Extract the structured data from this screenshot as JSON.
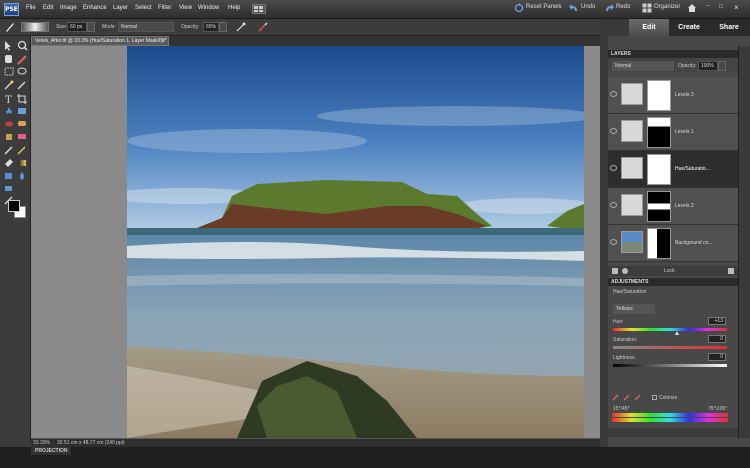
{
  "app": {
    "logo": "PSE"
  },
  "menubar": {
    "items": [
      "File",
      "Edit",
      "Image",
      "Enhance",
      "Layer",
      "Select",
      "Filter",
      "View",
      "Window",
      "Help"
    ],
    "reset_panels": "Reset Panels",
    "undo": "Undo",
    "redo": "Redo",
    "organizer": "Organizer"
  },
  "options": {
    "size_label": "Size:",
    "size_value": "60 px",
    "mode_label": "Mode:",
    "mode_value": "Normal",
    "opacity_label": "Opacity:",
    "opacity_value": "65%"
  },
  "mode_tabs": [
    "Edit",
    "Create",
    "Share"
  ],
  "document": {
    "tab_title": "Velvis_After.tif @ 33.3% (Hue/Saturation 1, Layer Mask/8) *"
  },
  "status": {
    "zoom": "33.33%",
    "dims": "32.51 cm x 48.77 cm (240 ppi)"
  },
  "project_bin": "PROJECTION",
  "layers_panel": {
    "title": "LAYERS",
    "blend_mode": "Normal",
    "opacity_label": "Opacity:",
    "opacity_value": "100%",
    "lock_label": "Lock:",
    "layers": [
      {
        "name": "Levels 3",
        "selected": false
      },
      {
        "name": "Levels 1",
        "selected": false
      },
      {
        "name": "Hue/Saturatio...",
        "selected": true
      },
      {
        "name": "Levels 2",
        "selected": false
      },
      {
        "name": "Background co...",
        "selected": false
      }
    ]
  },
  "adjustments_panel": {
    "title": "ADJUSTMENTS",
    "subtitle": "Hue/Saturation",
    "channel": "Yellows",
    "hue_label": "Hue:",
    "hue_value": "+13",
    "saturation_label": "Saturation:",
    "saturation_value": "0",
    "lightness_label": "Lightness:",
    "lightness_value": "0",
    "colorize_label": "Colorize",
    "range_left": "15°/45°",
    "range_right": "75°\\105°"
  },
  "colors": {
    "accent": "#5b8fd6",
    "panel": "#484848",
    "selected_layer": "#2e2e2e"
  }
}
